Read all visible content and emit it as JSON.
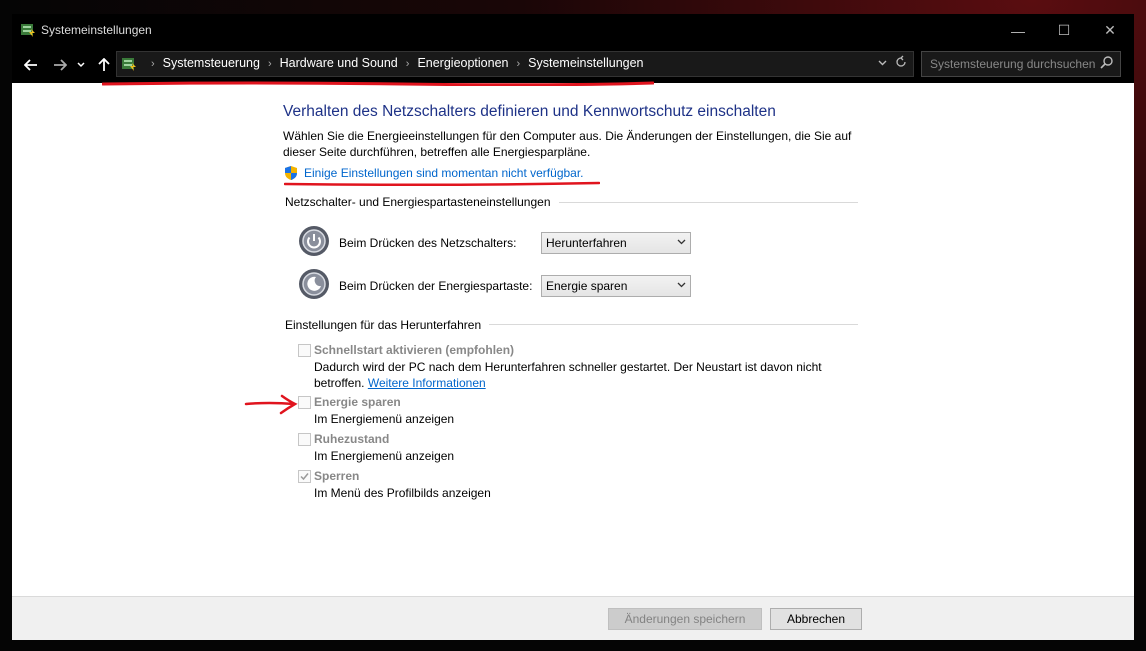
{
  "window": {
    "title": "Systemeinstellungen",
    "controls": [
      "—",
      "☐",
      "✕"
    ]
  },
  "nav": {
    "breadcrumbs": [
      "Systemsteuerung",
      "Hardware und Sound",
      "Energieoptionen",
      "Systemeinstellungen"
    ],
    "search_placeholder": "Systemsteuerung durchsuchen"
  },
  "main": {
    "heading": "Verhalten des Netzschalters definieren und Kennwortschutz einschalten",
    "description": "Wählen Sie die Energieeinstellungen für den Computer aus. Die Änderungen der Einstellungen, die Sie auf dieser Seite durchführen, betreffen alle Energiesparpläne.",
    "unavailable_link": "Einige Einstellungen sind momentan nicht verfügbar."
  },
  "buttons_section": {
    "label": "Netzschalter- und Energiespartasteneinstellungen",
    "rows": [
      {
        "label": "Beim Drücken des Netzschalters:",
        "value": "Herunterfahren"
      },
      {
        "label": "Beim Drücken der Energiespartaste:",
        "value": "Energie sparen"
      }
    ]
  },
  "shutdown_section": {
    "label": "Einstellungen für das Herunterfahren",
    "items": [
      {
        "title": "Schnellstart aktivieren (empfohlen)",
        "desc": "Dadurch wird der PC nach dem Herunterfahren schneller gestartet. Der Neustart ist davon nicht betroffen.",
        "link": "Weitere Informationen",
        "checked": false
      },
      {
        "title": "Energie sparen",
        "desc": "Im Energiemenü anzeigen",
        "checked": false
      },
      {
        "title": "Ruhezustand",
        "desc": "Im Energiemenü anzeigen",
        "checked": false
      },
      {
        "title": "Sperren",
        "desc": "Im Menü des Profilbilds anzeigen",
        "checked": true
      }
    ]
  },
  "footer": {
    "save_label": "Änderungen speichern",
    "cancel_label": "Abbrechen"
  },
  "colors": {
    "heading": "#1e3287",
    "link": "#0066cc",
    "annotation": "#e0141e"
  }
}
